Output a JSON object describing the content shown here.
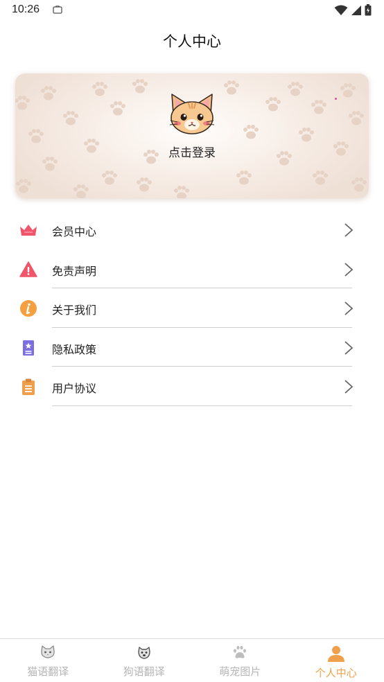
{
  "status_bar": {
    "time": "10:26"
  },
  "header": {
    "title": "个人中心"
  },
  "login_card": {
    "label": "点击登录"
  },
  "menu": {
    "items": [
      {
        "label": "会员中心",
        "icon": "crown-icon",
        "color": "#f0556a"
      },
      {
        "label": "免责声明",
        "icon": "warning-icon",
        "color": "#f0556a"
      },
      {
        "label": "关于我们",
        "icon": "info-icon",
        "color": "#f5a040"
      },
      {
        "label": "隐私政策",
        "icon": "document-star-icon",
        "color": "#7a6ee0"
      },
      {
        "label": "用户协议",
        "icon": "clipboard-icon",
        "color": "#f0a04a"
      }
    ]
  },
  "bottom_nav": {
    "active_color": "#f0a04a",
    "inactive_color": "#b5b5b5",
    "items": [
      {
        "label": "猫语翻译",
        "icon": "cat-face-icon",
        "active": false
      },
      {
        "label": "狗语翻译",
        "icon": "dog-face-icon",
        "active": false
      },
      {
        "label": "萌宠图片",
        "icon": "paw-icon",
        "active": false
      },
      {
        "label": "个人中心",
        "icon": "person-icon",
        "active": true
      }
    ]
  }
}
